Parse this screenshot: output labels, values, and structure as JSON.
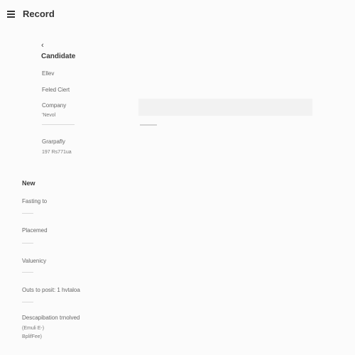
{
  "header": {
    "title": "Record"
  },
  "candidate": {
    "back_glyph": "‹",
    "title": "Candidate",
    "field_1_label": "Ellev",
    "field_2_label": "Feled Ciert",
    "company_label": "Company",
    "company_value": "'Nevol",
    "geography_label": "Grarpafly",
    "geography_value": "197 Rs771ua"
  },
  "new_section": {
    "title": "New",
    "fields": [
      {
        "label": "Fasting to"
      },
      {
        "label": "Placemed"
      },
      {
        "label": "Valuenicy"
      },
      {
        "label": "Outs to posit: 1 hvtaloa"
      }
    ],
    "description_label": "Descapibation trnolved",
    "description_line_1": "(Emuli E-)",
    "description_line_2": "BplifFee)"
  },
  "colors": {
    "background": "#fbfbfb",
    "input_fill": "#f2f2f2",
    "underline": "#d9d9d9"
  }
}
